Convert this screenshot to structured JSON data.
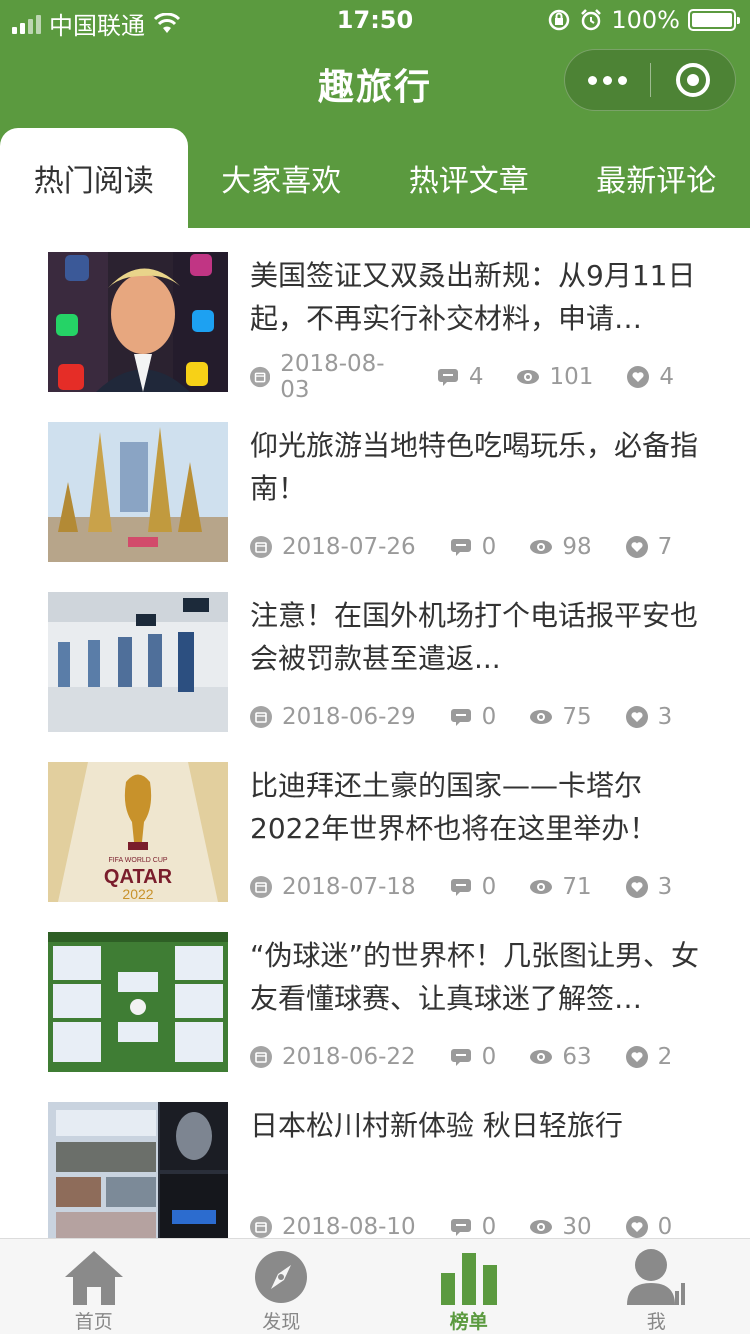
{
  "status_bar": {
    "carrier": "中国联通",
    "time": "17:50",
    "battery": "100%",
    "battery_level": 1.0
  },
  "header": {
    "title": "趣旅行"
  },
  "tabs": [
    {
      "label": "热门阅读",
      "active": true
    },
    {
      "label": "大家喜欢",
      "active": false
    },
    {
      "label": "热评文章",
      "active": false
    },
    {
      "label": "最新评论",
      "active": false
    }
  ],
  "articles": [
    {
      "title": "美国签证又双叒出新规：从9月11日起，不再实行补交材料，申请…",
      "date": "2018-08-03",
      "comments": "4",
      "views": "101",
      "likes": "4"
    },
    {
      "title": "仰光旅游当地特色吃喝玩乐，必备指南！",
      "date": "2018-07-26",
      "comments": "0",
      "views": "98",
      "likes": "7"
    },
    {
      "title": "注意！在国外机场打个电话报平安也会被罚款甚至遣返...",
      "date": "2018-06-29",
      "comments": "0",
      "views": "75",
      "likes": "3"
    },
    {
      "title": "比迪拜还土豪的国家——卡塔尔 2022年世界杯也将在这里举办！",
      "date": "2018-07-18",
      "comments": "0",
      "views": "71",
      "likes": "3"
    },
    {
      "title": "“伪球迷”的世界杯！几张图让男、女友看懂球赛、让真球迷了解签…",
      "date": "2018-06-22",
      "comments": "0",
      "views": "63",
      "likes": "2"
    },
    {
      "title": "日本松川村新体验 秋日轻旅行",
      "date": "2018-08-10",
      "comments": "0",
      "views": "30",
      "likes": "0"
    }
  ],
  "tabbar": [
    {
      "label": "首页",
      "icon": "home-icon"
    },
    {
      "label": "发现",
      "icon": "compass-icon"
    },
    {
      "label": "榜单",
      "icon": "chart-icon",
      "active": true
    },
    {
      "label": "我",
      "icon": "user-icon"
    }
  ],
  "colors": {
    "primary": "#5b9a3f",
    "text": "#333333",
    "meta": "#9a9a9a"
  }
}
